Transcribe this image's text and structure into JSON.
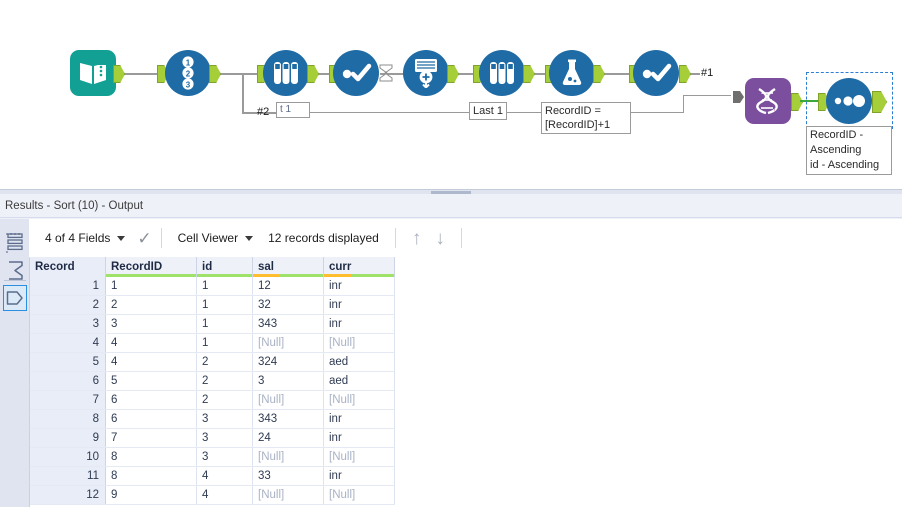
{
  "canvas": {
    "tools": [
      {
        "name": "input-data-tool",
        "icon": "book-icon",
        "color": "#12a094"
      },
      {
        "name": "record-id-tool",
        "icon": "numbers-123-icon",
        "color": "#1f6ba5"
      },
      {
        "name": "select-tool-1",
        "icon": "test-tubes-icon",
        "color": "#1f6ba5"
      },
      {
        "name": "filter-tool-1",
        "icon": "check-dot-icon",
        "color": "#1f6ba5"
      },
      {
        "name": "union-tool",
        "icon": "union-stack-icon",
        "color": "#1f6ba5"
      },
      {
        "name": "select-tool-2",
        "icon": "test-tubes-icon",
        "color": "#1f6ba5"
      },
      {
        "name": "formula-tool",
        "icon": "flask-icon",
        "color": "#1f6ba5"
      },
      {
        "name": "filter-tool-2",
        "icon": "check-dot-icon",
        "color": "#1f6ba5"
      },
      {
        "name": "multi-row-formula-tool",
        "icon": "dna-helix-icon",
        "color": "#7b4f9d"
      },
      {
        "name": "sort-tool",
        "icon": "three-dots-icon",
        "color": "#1f6ba5"
      }
    ],
    "annotations": {
      "sample_last": "Last 1",
      "formula": "RecordID =\n[RecordID]+1",
      "sort": "RecordID -\nAscending\nid - Ascending",
      "partial_box": "t 1"
    },
    "labels": {
      "anchor_one": "#1",
      "anchor_two": "#2"
    }
  },
  "results": {
    "title": "Results - Sort (10) - Output",
    "toolbar": {
      "fields_label": "4 of 4 Fields",
      "viewer_label": "Cell Viewer",
      "records_label": "12 records displayed",
      "check_icon": "checkmark-icon",
      "up_icon": "arrow-up-icon",
      "down_icon": "arrow-down-icon"
    },
    "rail": {
      "items": [
        {
          "name": "rail-grid-icon",
          "label": "grid-rows-icon",
          "selected": false
        },
        {
          "name": "rail-sigma-icon",
          "label": "sigma-icon",
          "selected": false
        },
        {
          "name": "rail-tag-icon",
          "label": "pentagon-tag-icon",
          "selected": true
        }
      ]
    },
    "grid": {
      "columns": [
        {
          "key": "record",
          "label": "Record",
          "width": 70,
          "bar": null
        },
        {
          "key": "recordid",
          "label": "RecordID",
          "width": 85,
          "bar": {
            "green": 100,
            "orange": 0
          }
        },
        {
          "key": "id",
          "label": "id",
          "width": 50,
          "bar": {
            "green": 100,
            "orange": 0
          }
        },
        {
          "key": "sal",
          "label": "sal",
          "width": 65,
          "bar": {
            "green": 100,
            "orange": 38
          }
        },
        {
          "key": "curr",
          "label": "curr",
          "width": 65,
          "bar": {
            "green": 100,
            "orange": 38
          }
        }
      ],
      "rows": [
        {
          "record": "1",
          "recordid": "1",
          "id": "1",
          "sal": "12",
          "curr": "inr"
        },
        {
          "record": "2",
          "recordid": "2",
          "id": "1",
          "sal": "32",
          "curr": "inr"
        },
        {
          "record": "3",
          "recordid": "3",
          "id": "1",
          "sal": "343",
          "curr": "inr"
        },
        {
          "record": "4",
          "recordid": "4",
          "id": "1",
          "sal": "[Null]",
          "curr": "[Null]"
        },
        {
          "record": "5",
          "recordid": "4",
          "id": "2",
          "sal": "324",
          "curr": "aed"
        },
        {
          "record": "6",
          "recordid": "5",
          "id": "2",
          "sal": "3",
          "curr": "aed"
        },
        {
          "record": "7",
          "recordid": "6",
          "id": "2",
          "sal": "[Null]",
          "curr": "[Null]"
        },
        {
          "record": "8",
          "recordid": "6",
          "id": "3",
          "sal": "343",
          "curr": "inr"
        },
        {
          "record": "9",
          "recordid": "7",
          "id": "3",
          "sal": "24",
          "curr": "inr"
        },
        {
          "record": "10",
          "recordid": "8",
          "id": "3",
          "sal": "[Null]",
          "curr": "[Null]"
        },
        {
          "record": "11",
          "recordid": "8",
          "id": "4",
          "sal": "33",
          "curr": "inr"
        },
        {
          "record": "12",
          "recordid": "9",
          "id": "4",
          "sal": "[Null]",
          "curr": "[Null]"
        }
      ]
    }
  },
  "colors": {
    "tool_blue": "#1f6ba5",
    "tool_teal": "#12a094",
    "tool_purple": "#7b4f9d",
    "anchor_green": "#a6ce39",
    "header_green": "#9fe26a",
    "header_orange": "#ffbe2e",
    "panel_bg": "#eef1f8",
    "select_blue": "#2a7fd4"
  }
}
